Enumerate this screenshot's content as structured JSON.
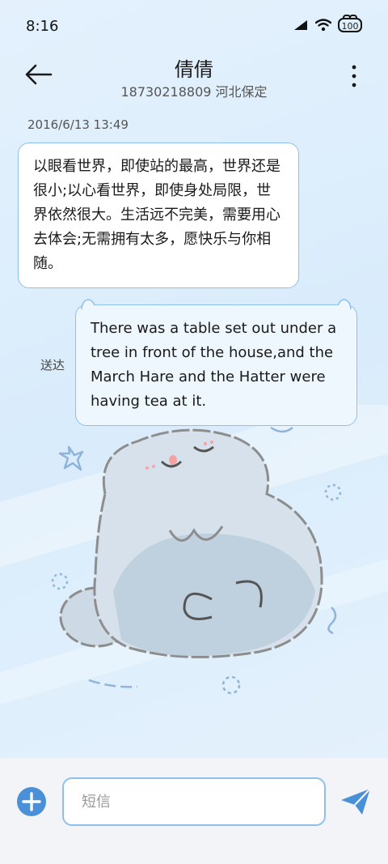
{
  "status_bar": {
    "time": "8:16",
    "battery": "100",
    "icons": [
      "signal-icon",
      "wifi-icon",
      "battery-icon"
    ]
  },
  "header": {
    "contact_name": "倩倩",
    "contact_subtitle": "18730218809 河北保定",
    "icons": [
      "back-arrow-icon",
      "more-vertical-icon"
    ]
  },
  "conversation": {
    "timestamp": "2016/6/13 13:49",
    "messages": [
      {
        "direction": "incoming",
        "text": "以眼看世界，即使站的最高，世界还是很小;以心看世界，即使身处局限，世界依然很大。生活远不完美，需要用心去体会;无需拥有太多，愿快乐与你相随。"
      },
      {
        "direction": "outgoing",
        "text": "There was a table set out under a tree in front of the house,and the March Hare and the Hatter were having tea at it.",
        "status": "送达"
      }
    ]
  },
  "composer": {
    "placeholder": "短信",
    "value": "",
    "icons": [
      "add-circle-icon",
      "send-icon"
    ]
  },
  "colors": {
    "accent": "#4a90d9",
    "bubble_border": "#8fc0ec",
    "background": "#dcedfb"
  }
}
